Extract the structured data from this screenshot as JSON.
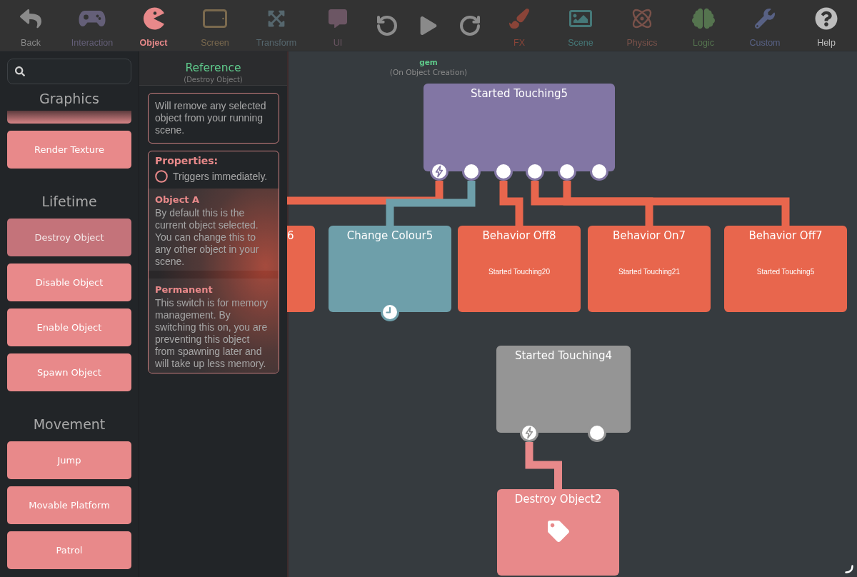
{
  "toolbar": {
    "left_items": [
      {
        "label": "Back",
        "color": "#8a8a8a",
        "selected": false
      },
      {
        "label": "Interaction",
        "color": "#645f78",
        "selected": false
      },
      {
        "label": "Object",
        "color": "#e8898a",
        "selected": true
      },
      {
        "label": "Screen",
        "color": "#7a694e",
        "selected": false
      },
      {
        "label": "Transform",
        "color": "#56676e",
        "selected": false
      },
      {
        "label": "UI",
        "color": "#6c5664",
        "selected": false
      }
    ],
    "right_items": [
      {
        "label": "FX",
        "color": "#8a4438",
        "selected": false
      },
      {
        "label": "Scene",
        "color": "#467878",
        "selected": false
      },
      {
        "label": "Physics",
        "color": "#7a524a",
        "selected": false
      },
      {
        "label": "Logic",
        "color": "#55744f",
        "selected": false
      },
      {
        "label": "Custom",
        "color": "#586184",
        "selected": false
      },
      {
        "label": "Help",
        "color": "#bdbdbd",
        "selected": false
      }
    ]
  },
  "sidebar": {
    "clipped_item_above": true,
    "sections": [
      {
        "title": "Graphics",
        "items": [
          {
            "label": "Render Texture",
            "selected": false
          }
        ]
      },
      {
        "title": "Lifetime",
        "items": [
          {
            "label": "Destroy Object",
            "selected": true
          },
          {
            "label": "Disable Object",
            "selected": false
          },
          {
            "label": "Enable Object",
            "selected": false
          },
          {
            "label": "Spawn Object",
            "selected": false
          }
        ]
      },
      {
        "title": "Movement",
        "items": [
          {
            "label": "Jump",
            "selected": false
          },
          {
            "label": "Movable Platform",
            "selected": false
          },
          {
            "label": "Patrol",
            "selected": false
          }
        ]
      }
    ]
  },
  "reference": {
    "title": "Reference",
    "subtitle": "(Destroy Object)",
    "description": "Will remove any selected object from your running scene.",
    "properties": {
      "heading": "Properties:",
      "trigger": {
        "label": "Triggers immediately.",
        "checked": false
      },
      "params": [
        {
          "name": "Object A",
          "text": "By default this is the current object selected. You can change this to any other object in your scene."
        },
        {
          "name": "Permanent",
          "text": "This switch is for memory management. By switching this on, you are preventing this object from spawning later and will take up less memory."
        }
      ]
    }
  },
  "canvas": {
    "object_label": {
      "name": "gem",
      "event": "(On Object Creation)"
    },
    "nodes": [
      {
        "kind": "trigger",
        "title": "Started Touching5",
        "color": "#8276a4",
        "timer": false,
        "tagged": false,
        "ports": [
          {
            "kind": "trigger",
            "connected": true
          },
          {
            "kind": "output",
            "connected": true
          },
          {
            "kind": "output",
            "connected": true
          },
          {
            "kind": "output",
            "connected": true
          },
          {
            "kind": "output",
            "connected": true
          },
          {
            "kind": "output",
            "connected": false
          }
        ]
      },
      {
        "kind": "action",
        "title": "6",
        "color": "#e8664d",
        "timer": false,
        "tagged": false
      },
      {
        "kind": "action",
        "title": "Change Colour5",
        "color": "#6e9faa",
        "timer": true,
        "tagged": false
      },
      {
        "kind": "action",
        "title": "Behavior Off8",
        "subtitle": "Started Touching20",
        "color": "#e8664d",
        "timer": false,
        "tagged": false
      },
      {
        "kind": "action",
        "title": "Behavior On7",
        "subtitle": "Started Touching21",
        "color": "#e8664d",
        "timer": false,
        "tagged": false
      },
      {
        "kind": "action",
        "title": "Behavior Off7",
        "subtitle": "Started Touching5",
        "color": "#e8664d",
        "timer": false,
        "tagged": false
      },
      {
        "kind": "trigger",
        "title": "Started Touching4",
        "color": "#959595",
        "timer": false,
        "tagged": false,
        "ports": [
          {
            "kind": "trigger",
            "connected": true
          },
          {
            "kind": "output",
            "connected": false
          }
        ]
      },
      {
        "kind": "action",
        "title": "Destroy Object2",
        "color": "#e8898a",
        "timer": false,
        "tagged": true
      }
    ]
  }
}
